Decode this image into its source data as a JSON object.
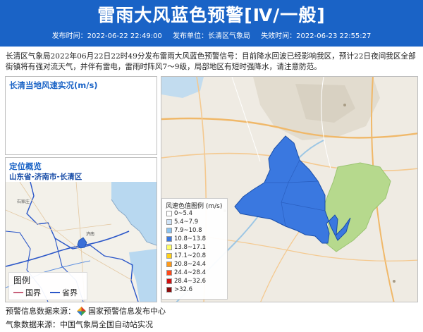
{
  "header": {
    "title": "雷雨大风蓝色预警[Ⅳ/一般]",
    "issue_time": "发布时间：2022-06-22 22:49:00",
    "issuer": "发布单位：长清区气象局",
    "expire_time": "失效时间：2022-06-23 22:55:27",
    "bg_color": "#1a63c6"
  },
  "description": "长清区气象局2022年06月22日22时49分发布雷雨大风蓝色预警信号：目前降水回波已经影响我区，预计22日夜间我区全部街镇将有强对流天气，并伴有雷电，雷雨时阵风7～9级，局部地区有短时强降水，请注意防范。",
  "wind_panel": {
    "title": "长清当地风速实况(m/s)"
  },
  "locate_panel": {
    "title": "定位概览",
    "location": "山东省-济南市-长清区",
    "map_labels": [
      "石家庄",
      "济南"
    ],
    "legend": {
      "title": "图例",
      "items": [
        {
          "label": "国界",
          "color": "#c8607a"
        },
        {
          "label": "省界",
          "color": "#2a56c8"
        }
      ]
    }
  },
  "wind_legend": {
    "title": "风速色值图例 (m/s)",
    "items": [
      {
        "label": "0~5.4",
        "color": "#ffffff"
      },
      {
        "label": "5.4~7.9",
        "color": "#cfe3f7"
      },
      {
        "label": "7.9~10.8",
        "color": "#8cc4f0"
      },
      {
        "label": "10.8~13.8",
        "color": "#3a78e0"
      },
      {
        "label": "13.8~17.1",
        "color": "#ffff66"
      },
      {
        "label": "17.1~20.8",
        "color": "#ffd11a"
      },
      {
        "label": "20.8~24.4",
        "color": "#ff9a1a"
      },
      {
        "label": "24.4~28.4",
        "color": "#ff4a1a"
      },
      {
        "label": "28.4~32.6",
        "color": "#d01010"
      },
      {
        "label": ">32.6",
        "color": "#8a0c0c"
      }
    ]
  },
  "footer": {
    "warning_source": "预警信息数据来源：",
    "warning_source_org": "国家预警信息发布中心",
    "weather_source": "气象数据来源：中国气象局全国自动站实况"
  }
}
